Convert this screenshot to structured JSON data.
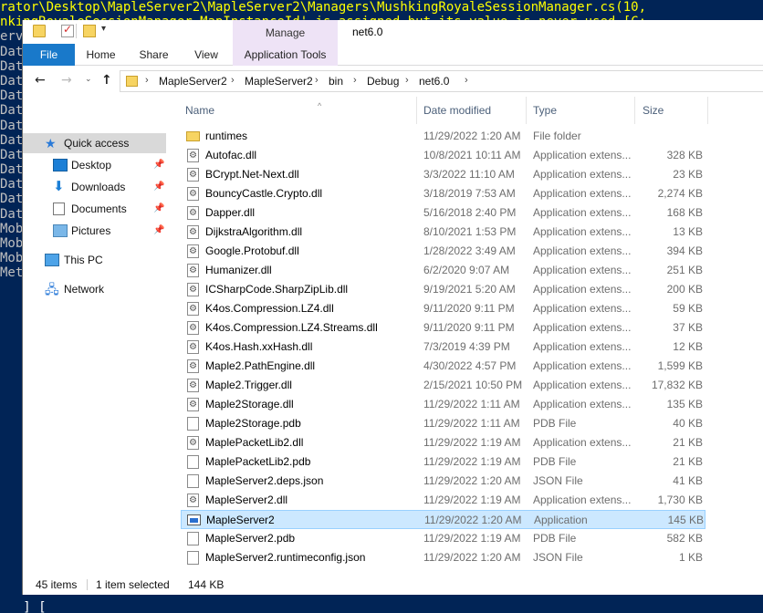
{
  "terminal": {
    "lines": [
      "rator\\Desktop\\MapleServer2\\MapleServer2\\Managers\\MushkingRoyaleSessionManager.cs(10,",
      "nkingRoyaleSessionManager.MapInstanceId' is assigned but its value is never used [C:",
      "erv",
      "Dat",
      "Dat",
      "Dat",
      "Dat",
      "Dat",
      "Dat",
      "Dat",
      "Dat",
      "Dat",
      "Dat",
      "Dat",
      "Dat",
      "Mob",
      "Mob",
      "Mob",
      "Met"
    ],
    "bottom": "   ] [  "
  },
  "window": {
    "title": "net6.0",
    "manage_tab": "Manage",
    "ribbon_tabs": {
      "file": "File",
      "home": "Home",
      "share": "Share",
      "view": "View",
      "app_tools": "Application Tools"
    }
  },
  "address": {
    "crumbs": [
      "MapleServer2",
      "MapleServer2",
      "bin",
      "Debug",
      "net6.0"
    ]
  },
  "navpane": {
    "quick_access": "Quick access",
    "desktop": "Desktop",
    "downloads": "Downloads",
    "documents": "Documents",
    "pictures": "Pictures",
    "this_pc": "This PC",
    "network": "Network"
  },
  "columns": {
    "name": "Name",
    "date": "Date modified",
    "type": "Type",
    "size": "Size"
  },
  "files": [
    {
      "name": "runtimes",
      "date": "11/29/2022 1:20 AM",
      "type": "File folder",
      "size": "",
      "kind": "folder"
    },
    {
      "name": "Autofac.dll",
      "date": "10/8/2021 10:11 AM",
      "type": "Application extens...",
      "size": "328 KB",
      "kind": "dll"
    },
    {
      "name": "BCrypt.Net-Next.dll",
      "date": "3/3/2022 11:10 AM",
      "type": "Application extens...",
      "size": "23 KB",
      "kind": "dll"
    },
    {
      "name": "BouncyCastle.Crypto.dll",
      "date": "3/18/2019 7:53 AM",
      "type": "Application extens...",
      "size": "2,274 KB",
      "kind": "dll"
    },
    {
      "name": "Dapper.dll",
      "date": "5/16/2018 2:40 PM",
      "type": "Application extens...",
      "size": "168 KB",
      "kind": "dll"
    },
    {
      "name": "DijkstraAlgorithm.dll",
      "date": "8/10/2021 1:53 PM",
      "type": "Application extens...",
      "size": "13 KB",
      "kind": "dll"
    },
    {
      "name": "Google.Protobuf.dll",
      "date": "1/28/2022 3:49 AM",
      "type": "Application extens...",
      "size": "394 KB",
      "kind": "dll"
    },
    {
      "name": "Humanizer.dll",
      "date": "6/2/2020 9:07 AM",
      "type": "Application extens...",
      "size": "251 KB",
      "kind": "dll"
    },
    {
      "name": "ICSharpCode.SharpZipLib.dll",
      "date": "9/19/2021 5:20 AM",
      "type": "Application extens...",
      "size": "200 KB",
      "kind": "dll"
    },
    {
      "name": "K4os.Compression.LZ4.dll",
      "date": "9/11/2020 9:11 PM",
      "type": "Application extens...",
      "size": "59 KB",
      "kind": "dll"
    },
    {
      "name": "K4os.Compression.LZ4.Streams.dll",
      "date": "9/11/2020 9:11 PM",
      "type": "Application extens...",
      "size": "37 KB",
      "kind": "dll"
    },
    {
      "name": "K4os.Hash.xxHash.dll",
      "date": "7/3/2019 4:39 PM",
      "type": "Application extens...",
      "size": "12 KB",
      "kind": "dll"
    },
    {
      "name": "Maple2.PathEngine.dll",
      "date": "4/30/2022 4:57 PM",
      "type": "Application extens...",
      "size": "1,599 KB",
      "kind": "dll"
    },
    {
      "name": "Maple2.Trigger.dll",
      "date": "2/15/2021 10:50 PM",
      "type": "Application extens...",
      "size": "17,832 KB",
      "kind": "dll"
    },
    {
      "name": "Maple2Storage.dll",
      "date": "11/29/2022 1:11 AM",
      "type": "Application extens...",
      "size": "135 KB",
      "kind": "dll"
    },
    {
      "name": "Maple2Storage.pdb",
      "date": "11/29/2022 1:11 AM",
      "type": "PDB File",
      "size": "40 KB",
      "kind": "file"
    },
    {
      "name": "MaplePacketLib2.dll",
      "date": "11/29/2022 1:19 AM",
      "type": "Application extens...",
      "size": "21 KB",
      "kind": "dll"
    },
    {
      "name": "MaplePacketLib2.pdb",
      "date": "11/29/2022 1:19 AM",
      "type": "PDB File",
      "size": "21 KB",
      "kind": "file"
    },
    {
      "name": "MapleServer2.deps.json",
      "date": "11/29/2022 1:20 AM",
      "type": "JSON File",
      "size": "41 KB",
      "kind": "file"
    },
    {
      "name": "MapleServer2.dll",
      "date": "11/29/2022 1:19 AM",
      "type": "Application extens...",
      "size": "1,730 KB",
      "kind": "dll"
    },
    {
      "name": "MapleServer2",
      "date": "11/29/2022 1:20 AM",
      "type": "Application",
      "size": "145 KB",
      "kind": "app",
      "selected": true
    },
    {
      "name": "MapleServer2.pdb",
      "date": "11/29/2022 1:19 AM",
      "type": "PDB File",
      "size": "582 KB",
      "kind": "file"
    },
    {
      "name": "MapleServer2.runtimeconfig.json",
      "date": "11/29/2022 1:20 AM",
      "type": "JSON File",
      "size": "1 KB",
      "kind": "file"
    }
  ],
  "status": {
    "item_count": "45 items",
    "selection": "1 item selected",
    "selection_size": "144 KB"
  }
}
